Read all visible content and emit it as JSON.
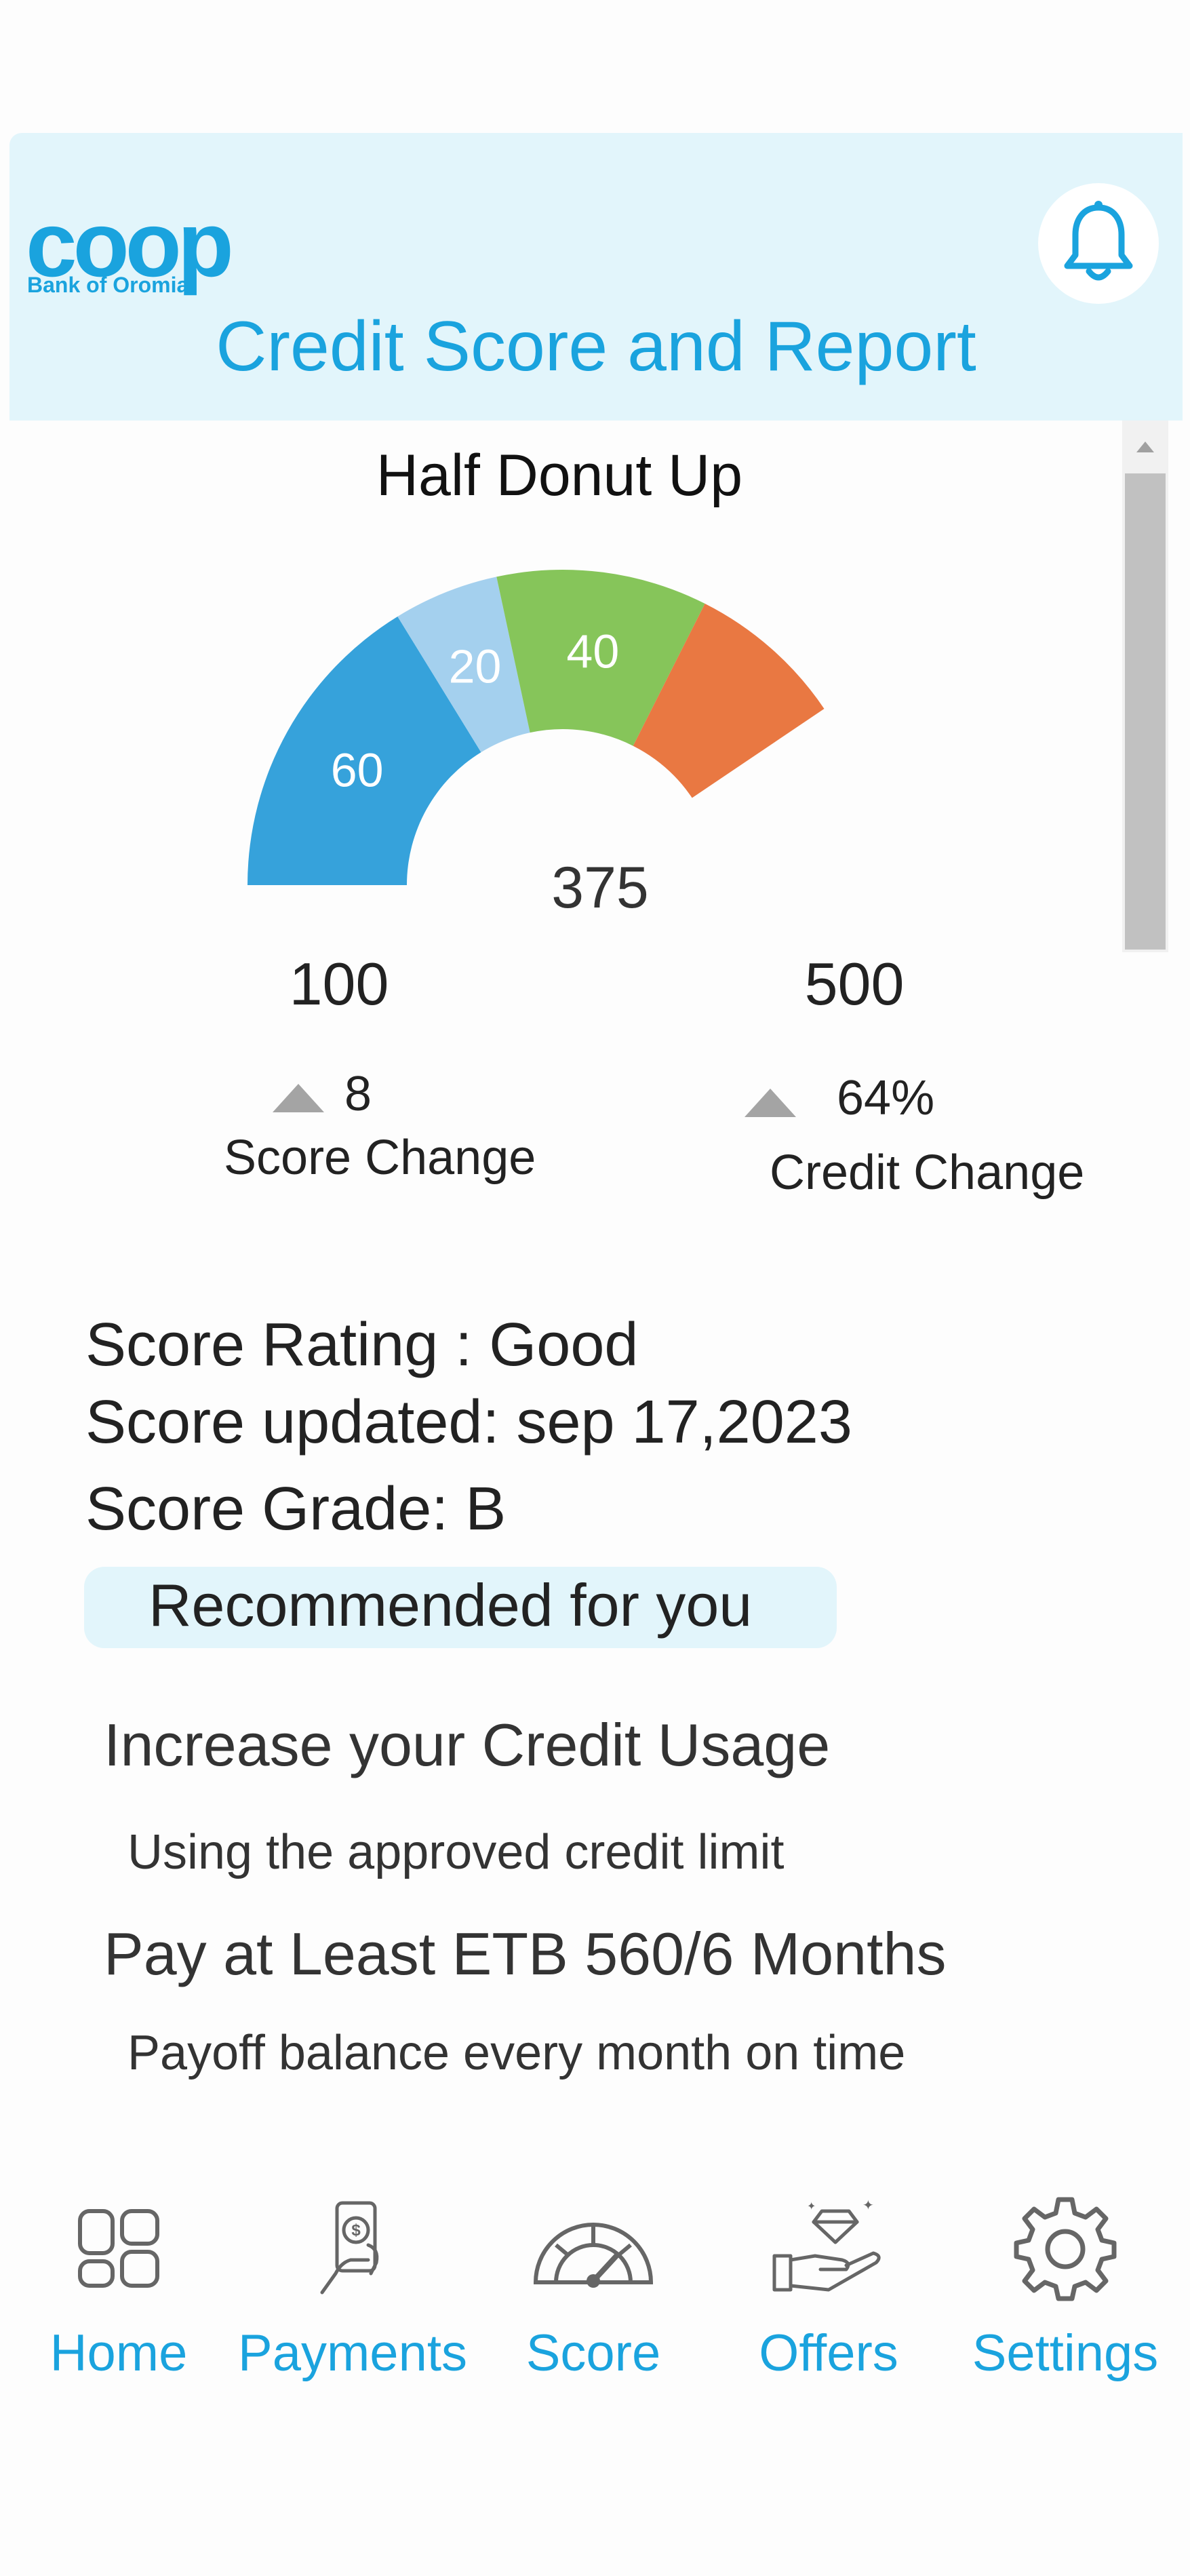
{
  "header": {
    "logo_word": "coop",
    "logo_sub": "Bank of Oromia",
    "title": "Credit Score and Report"
  },
  "gauge": {
    "title": "Half Donut Up",
    "value": "375",
    "min": "100",
    "max": "500",
    "segments": [
      {
        "label": "60",
        "value": 60,
        "color": "#36a2db"
      },
      {
        "label": "20",
        "value": 20,
        "color": "#a4d0ee"
      },
      {
        "label": "40",
        "value": 40,
        "color": "#86c55a"
      },
      {
        "label": "",
        "value": 30,
        "color": "#e97842"
      }
    ]
  },
  "changes": {
    "score": {
      "value": "8",
      "label": "Score Change"
    },
    "credit": {
      "value": "64%",
      "label": "Credit Change"
    }
  },
  "score_info": {
    "rating": "Score Rating : Good",
    "updated": "Score updated: sep 17,2023",
    "grade": "Score Grade:  B"
  },
  "recommended": {
    "label": "Recommended  for you"
  },
  "tips": [
    {
      "title": "Increase your Credit Usage",
      "subtitle": "Using the approved credit limit"
    },
    {
      "title": "Pay at Least ETB 560/6 Months",
      "subtitle": "Payoff balance every month on time"
    }
  ],
  "nav": [
    {
      "label": "Home",
      "icon": "home-icon"
    },
    {
      "label": "Payments",
      "icon": "payments-icon"
    },
    {
      "label": "Score",
      "icon": "score-icon"
    },
    {
      "label": "Offers",
      "icon": "offers-icon"
    },
    {
      "label": "Settings",
      "icon": "settings-icon"
    }
  ]
}
